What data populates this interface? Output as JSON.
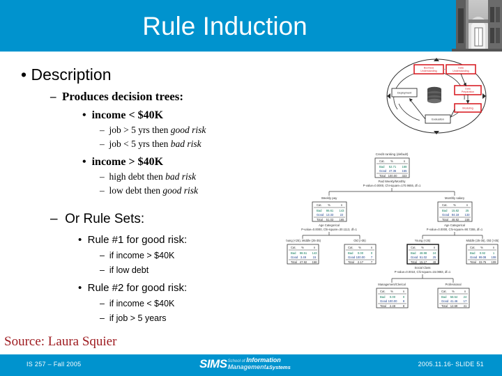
{
  "slide": {
    "title": "Rule Induction",
    "banner_color": "#0093ce",
    "source_note": "Source: Laura Squier",
    "source_color": "#9e1b20"
  },
  "content": {
    "bullet_marker_l1": "•",
    "bullet_marker_l2": "–",
    "bullet_marker_l3": "•",
    "bullet_marker_l4": "–",
    "description_heading": "Description",
    "produces_heading": "Produces decision trees:",
    "income_low": "income < $40K",
    "income_low_rule1_pre": "job > 5 yrs then ",
    "income_low_rule1_em": "good risk",
    "income_low_rule2_pre": "job < 5 yrs then ",
    "income_low_rule2_em": "bad risk",
    "income_high": "income > $40K",
    "income_high_rule1_pre": "high debt then ",
    "income_high_rule1_em": "bad risk",
    "income_high_rule2_pre": "low debt then ",
    "income_high_rule2_em": "good risk",
    "rulesets_heading": "Or Rule Sets:",
    "rule1_heading": "Rule #1 for good risk:",
    "rule1_cond1": "if income > $40K",
    "rule1_cond2": "if low debt",
    "rule2_heading": "Rule #2 for good risk:",
    "rule2_cond1": "if income < $40K",
    "rule2_cond2": "if job > 5 years"
  },
  "footer": {
    "left": "IS 257 – Fall 2005",
    "right": "2005.11.16- SLIDE 51",
    "logo_word": "SIMS",
    "logo_line1_small": "School of ",
    "logo_line1_big": "Information",
    "logo_line2_big": "Management",
    "logo_line2_amp": "&",
    "logo_line2_sys": "Systems"
  },
  "crisp_diagram": {
    "nodes": [
      {
        "label": "Business Understanding",
        "style": "red"
      },
      {
        "label": "Data Understanding",
        "style": "red"
      },
      {
        "label": "Data Preparation",
        "style": "red"
      },
      {
        "label": "Modeling",
        "style": "red"
      },
      {
        "label": "Evaluation",
        "style": "white"
      },
      {
        "label": "Deployment",
        "style": "white"
      }
    ],
    "accent_color": "#d81f26"
  },
  "tree_diagram": {
    "root_title": "Credit ranking (default)",
    "columns": [
      "Cat.",
      "%",
      "n"
    ],
    "nodes": [
      {
        "id": "root",
        "title": "Credit ranking (default)",
        "rows": [
          {
            "cat": "Bad",
            "pct": "52.71",
            "n": "168"
          },
          {
            "cat": "Good",
            "pct": "47.36",
            "n": "155"
          },
          {
            "cat": "Total",
            "pct": "100.00",
            "n": "323"
          }
        ],
        "split_label": "Paid Weekly/Monthly",
        "split_stats": "P-value=0.0000, Chi-square=170.9655, df=1"
      },
      {
        "id": "weekly",
        "title": "Weekly pay",
        "rows": [
          {
            "cat": "Bad",
            "pct": "86.61",
            "n": "143"
          },
          {
            "cat": "Good",
            "pct": "13.33",
            "n": "22"
          },
          {
            "cat": "Total",
            "pct": "51.03",
            "n": "165"
          }
        ],
        "split_label": "Age Categorical",
        "split_stats": "P-value=0.0000, Chi-square=30.1113, df=1"
      },
      {
        "id": "monthly",
        "title": "Monthly salary",
        "rows": [
          {
            "cat": "Bad",
            "pct": "15.82",
            "n": "25"
          },
          {
            "cat": "Good",
            "pct": "84.18",
            "n": "133"
          },
          {
            "cat": "Total",
            "pct": "48.92",
            "n": "158"
          }
        ],
        "split_label": "Age Categorical",
        "split_stats": "P-value=0.0000, Chi-square=90.7255, df=1"
      },
      {
        "id": "weekly-young",
        "title": "Young (<25), Middle (25-35)",
        "rows": [
          {
            "cat": "Bad",
            "pct": "98.51",
            "n": "143"
          },
          {
            "cat": "Good",
            "pct": "3.49",
            "n": "15"
          },
          {
            "cat": "Total",
            "pct": "47.92",
            "n": "158"
          }
        ]
      },
      {
        "id": "weekly-old",
        "title": "Old (>35)",
        "rows": [
          {
            "cat": "Bad",
            "pct": "0.00",
            "n": "0"
          },
          {
            "cat": "Good",
            "pct": "100.00",
            "n": "7"
          },
          {
            "cat": "Total",
            "pct": "2.17",
            "n": "7"
          }
        ]
      },
      {
        "id": "monthly-young",
        "title": "Young (<25)",
        "rows": [
          {
            "cat": "Bad",
            "pct": "48.98",
            "n": "24"
          },
          {
            "cat": "Good",
            "pct": "51.02",
            "n": "25"
          },
          {
            "cat": "Total",
            "pct": "15.17",
            "n": "49"
          }
        ],
        "split_label": "Social Class",
        "split_stats": "P-value=0.0010, Chi-square=15.0883, df=1"
      },
      {
        "id": "monthly-old",
        "title": "Middle (25-35), Old (>35)",
        "rows": [
          {
            "cat": "Bad",
            "pct": "0.92",
            "n": "1"
          },
          {
            "cat": "Good",
            "pct": "99.08",
            "n": "108"
          },
          {
            "cat": "Total",
            "pct": "33.75",
            "n": "109"
          }
        ]
      },
      {
        "id": "mgmt",
        "title": "Management/Clerical",
        "rows": [
          {
            "cat": "Bad",
            "pct": "0.00",
            "n": "0"
          },
          {
            "cat": "Good",
            "pct": "100.00",
            "n": "8"
          },
          {
            "cat": "Total",
            "pct": "2.48",
            "n": "8"
          }
        ]
      },
      {
        "id": "prof",
        "title": "Professional",
        "rows": [
          {
            "cat": "Bad",
            "pct": "58.54",
            "n": "24"
          },
          {
            "cat": "Good",
            "pct": "41.46",
            "n": "17"
          },
          {
            "cat": "Total",
            "pct": "12.69",
            "n": "41"
          }
        ]
      }
    ]
  }
}
